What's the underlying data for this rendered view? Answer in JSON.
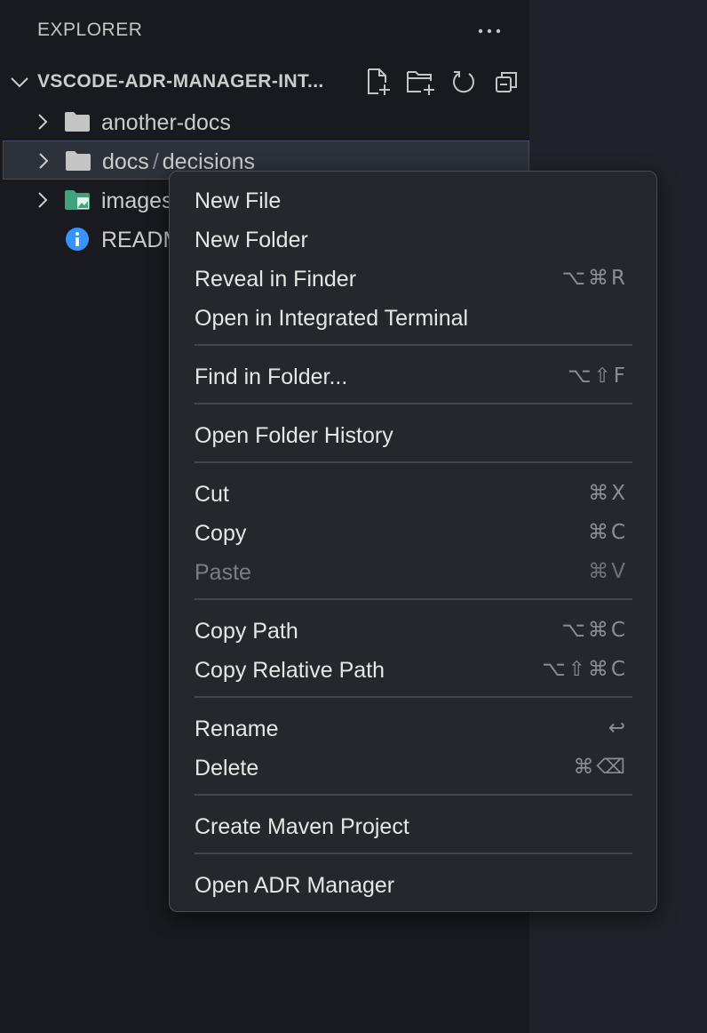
{
  "explorer": {
    "title": "EXPLORER",
    "more_icon": "ellipsis-icon",
    "section_title": "VSCODE-ADR-MANAGER-INT...",
    "actions": [
      "new-file-icon",
      "new-folder-icon",
      "refresh-icon",
      "collapse-all-icon"
    ]
  },
  "tree": [
    {
      "label": "another-docs",
      "icon": "folder-icon",
      "has_chevron": true
    },
    {
      "label": "docs",
      "label2": "decisions",
      "icon": "folder-icon",
      "has_chevron": true,
      "selected": true
    },
    {
      "label": "images",
      "icon": "image-folder-icon",
      "has_chevron": true
    },
    {
      "label": "README.md",
      "icon": "info-icon",
      "has_chevron": false
    }
  ],
  "context_menu": {
    "items": [
      {
        "label": "New File",
        "shortcut": ""
      },
      {
        "label": "New Folder",
        "shortcut": ""
      },
      {
        "label": "Reveal in Finder",
        "shortcut": "⌥⌘R"
      },
      {
        "label": "Open in Integrated Terminal",
        "shortcut": ""
      },
      {
        "label": "Find in Folder...",
        "shortcut": "⌥⇧F"
      },
      {
        "label": "Open Folder History",
        "shortcut": ""
      },
      {
        "label": "Cut",
        "shortcut": "⌘X"
      },
      {
        "label": "Copy",
        "shortcut": "⌘C"
      },
      {
        "label": "Paste",
        "shortcut": "⌘V",
        "disabled": true
      },
      {
        "label": "Copy Path",
        "shortcut": "⌥⌘C"
      },
      {
        "label": "Copy Relative Path",
        "shortcut": "⌥⇧⌘C"
      },
      {
        "label": "Rename",
        "shortcut": "↩"
      },
      {
        "label": "Delete",
        "shortcut": "⌘⌫"
      },
      {
        "label": "Create Maven Project",
        "shortcut": ""
      },
      {
        "label": "Open ADR Manager",
        "shortcut": ""
      }
    ]
  },
  "colors": {
    "sidebar": "#181a1f",
    "menu_bg": "#25272d",
    "selection": "#2c313a",
    "folder": "#c5c5c5",
    "image_folder": "#3fa37f",
    "info": "#3794ff"
  }
}
